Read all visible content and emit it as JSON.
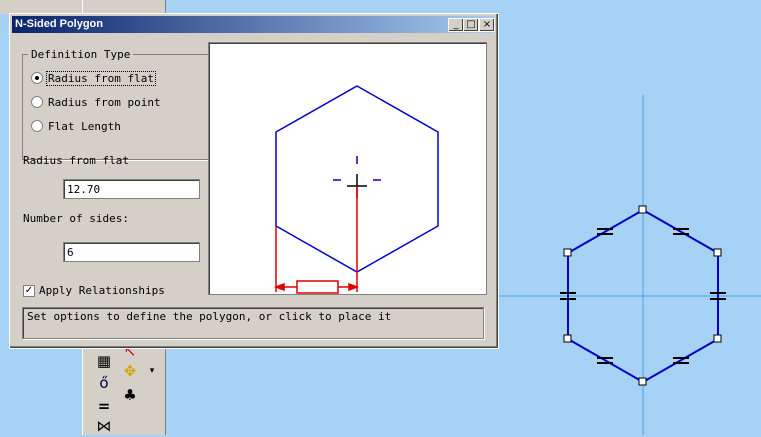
{
  "dialog": {
    "title": "N-Sided Polygon",
    "title_buttons": {
      "minimize": "_",
      "maximize": "□",
      "close": "×"
    },
    "definition_group_label": "Definition Type",
    "radio_options": [
      {
        "label": "Radius from flat",
        "selected": true
      },
      {
        "label": "Radius from point",
        "selected": false
      },
      {
        "label": "Flat Length",
        "selected": false
      }
    ],
    "radius_label": "Radius from flat",
    "radius_value": "12.70",
    "sides_label": "Number of sides:",
    "sides_value": "6",
    "apply_relationships_label": "Apply Relationships",
    "apply_relationships_checked": true,
    "status_text": "Set options to define the polygon, or click to place it"
  },
  "colors": {
    "canvas_bg": "#a6d2f5",
    "polygon": "#0000cc",
    "dimension": "#e00000",
    "crosshair": "#4aa3e6",
    "title_start": "#0a246a",
    "title_end": "#a6caf0"
  },
  "toolbar_icons": [
    "arc-icon",
    "move-icon",
    "club-icon",
    "equal-icon",
    "tangent-icon",
    "symmetric-icon",
    "dimension-icon"
  ]
}
